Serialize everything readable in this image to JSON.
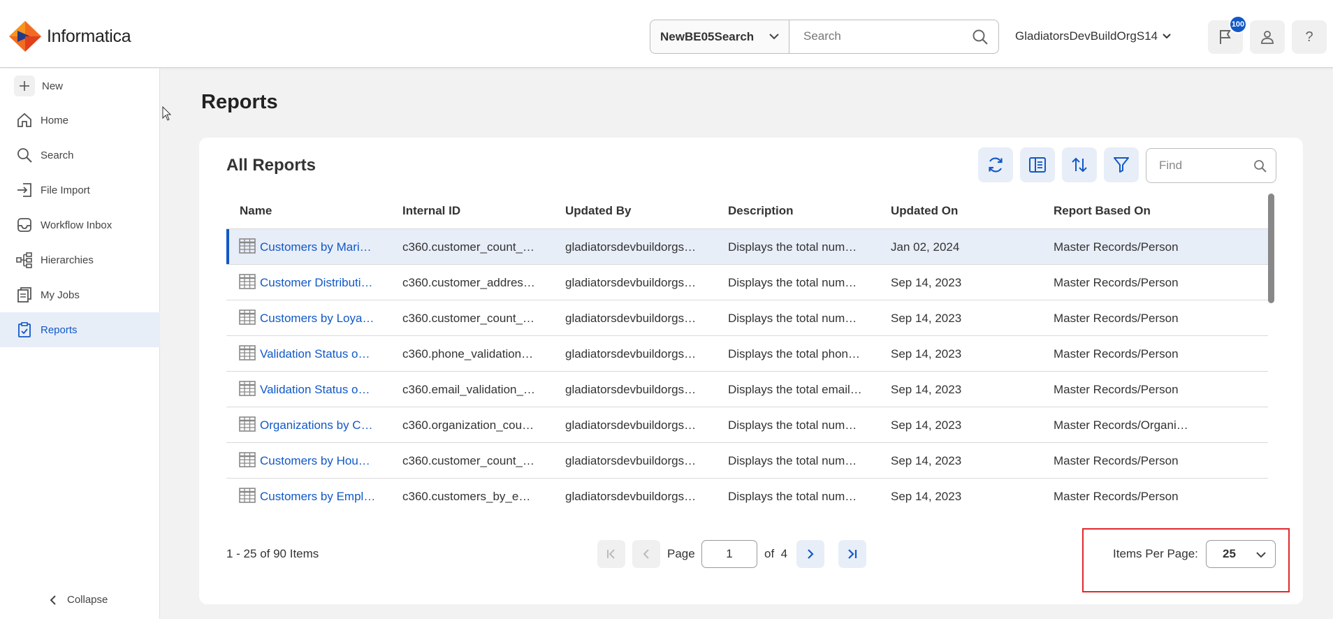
{
  "header": {
    "logo_text": "Informatica",
    "scope_value": "NewBE05Search",
    "search_placeholder": "Search",
    "org_name": "GladiatorsDevBuildOrgS14",
    "notification_count": "100"
  },
  "sidebar": {
    "items": [
      {
        "label": "New",
        "icon": "plus-icon"
      },
      {
        "label": "Home",
        "icon": "home-icon"
      },
      {
        "label": "Search",
        "icon": "search-icon"
      },
      {
        "label": "File Import",
        "icon": "file-import-icon"
      },
      {
        "label": "Workflow Inbox",
        "icon": "inbox-icon"
      },
      {
        "label": "Hierarchies",
        "icon": "hierarchy-icon"
      },
      {
        "label": "My Jobs",
        "icon": "jobs-icon"
      },
      {
        "label": "Reports",
        "icon": "reports-icon",
        "active": true
      }
    ],
    "collapse_label": "Collapse"
  },
  "main": {
    "page_title": "Reports",
    "card_title": "All Reports",
    "find_placeholder": "Find",
    "columns": [
      "Name",
      "Internal ID",
      "Updated By",
      "Description",
      "Updated On",
      "Report Based On"
    ],
    "rows": [
      [
        "Customers by Mari…",
        "c360.customer_count_…",
        "gladiatorsdevbuildorgs…",
        "Displays the total num…",
        "Jan 02, 2024",
        "Master Records/Person"
      ],
      [
        "Customer Distributi…",
        "c360.customer_addres…",
        "gladiatorsdevbuildorgs…",
        "Displays the total num…",
        "Sep 14, 2023",
        "Master Records/Person"
      ],
      [
        "Customers by Loya…",
        "c360.customer_count_…",
        "gladiatorsdevbuildorgs…",
        "Displays the total num…",
        "Sep 14, 2023",
        "Master Records/Person"
      ],
      [
        "Validation Status o…",
        "c360.phone_validation…",
        "gladiatorsdevbuildorgs…",
        "Displays the total phon…",
        "Sep 14, 2023",
        "Master Records/Person"
      ],
      [
        "Validation Status o…",
        "c360.email_validation_…",
        "gladiatorsdevbuildorgs…",
        "Displays the total email…",
        "Sep 14, 2023",
        "Master Records/Person"
      ],
      [
        "Organizations by C…",
        "c360.organization_cou…",
        "gladiatorsdevbuildorgs…",
        "Displays the total num…",
        "Sep 14, 2023",
        "Master Records/Organi…"
      ],
      [
        "Customers by Hou…",
        "c360.customer_count_…",
        "gladiatorsdevbuildorgs…",
        "Displays the total num…",
        "Sep 14, 2023",
        "Master Records/Person"
      ],
      [
        "Customers by Empl…",
        "c360.customers_by_e…",
        "gladiatorsdevbuildorgs…",
        "Displays the total num…",
        "Sep 14, 2023",
        "Master Records/Person"
      ]
    ],
    "pager": {
      "info": "1 - 25 of 90 Items",
      "page_label": "Page",
      "current_page": "1",
      "of_label": "of",
      "total_pages": "4",
      "items_per_page_label": "Items Per Page:",
      "items_per_page": "25"
    }
  },
  "colors": {
    "accent": "#1158c7",
    "selected_row_bg": "#e8eef8",
    "highlight_border": "#e0292c"
  }
}
